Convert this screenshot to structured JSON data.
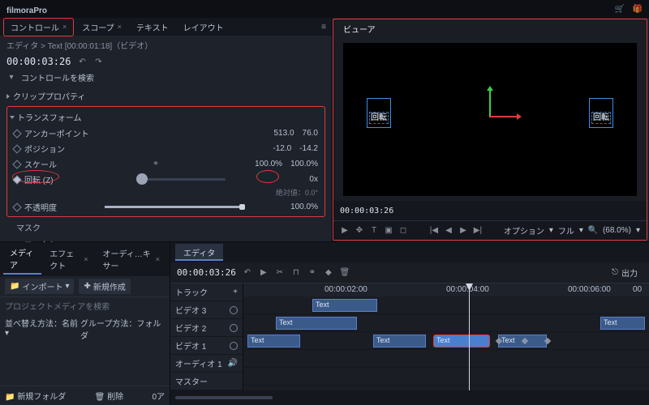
{
  "app": {
    "name": "filmoraPro"
  },
  "titlebar_icons": [
    "cart",
    "gift"
  ],
  "left": {
    "tabs": [
      {
        "label": "コントロール",
        "active": true,
        "closable": true
      },
      {
        "label": "スコープ",
        "closable": true
      },
      {
        "label": "テキスト"
      },
      {
        "label": "レイアウト"
      }
    ],
    "breadcrumb": "エディタ > Text [00:00:01:18]（ビデオ）",
    "timecode": "00:00:03:26",
    "search_placeholder": "コントロールを検索",
    "clip_props": "クリッププロパティ",
    "transform": {
      "title": "トランスフォーム",
      "rows": [
        {
          "name": "アンカーポイント",
          "v1": "513.0",
          "v2": "76.0"
        },
        {
          "name": "ポジション",
          "v1": "-12.0",
          "v2": "-14.2"
        },
        {
          "name": "スケール",
          "v1": "100.0%",
          "v2": "100.0%",
          "link": true
        },
        {
          "name": "回転 (Z)",
          "rot": "0x",
          "abs": "絶対値：0.0°"
        },
        {
          "name": "不透明度",
          "pct": "100.0%"
        }
      ]
    },
    "mask": "マスク",
    "effect": "エフェクト"
  },
  "viewer": {
    "tab": "ビューア",
    "text_left": "回転",
    "text_right": "回転",
    "tc": "00:00:03:26",
    "options": "オプション",
    "full": "フル",
    "zoom": "(68.0%)"
  },
  "media": {
    "tabs": [
      {
        "label": "メディア",
        "active": true
      },
      {
        "label": "エフェクト",
        "closable": true
      },
      {
        "label": "オーディ…キサー",
        "closable": true
      }
    ],
    "import": "インポート",
    "new": "新規作成",
    "search": "プロジェクトメディアを検索",
    "sort_label": "並べ替え方法：名前",
    "group_label": "グループ方法：フォルダ",
    "new_folder": "新規フォルダ",
    "delete": "削除",
    "count": "0ア"
  },
  "timeline": {
    "tab": "エディタ",
    "tc": "00:00:03:26",
    "export": "出力",
    "ruler": [
      "00:00:02:00",
      "00:00:04:00",
      "00:00:06:00",
      "00"
    ],
    "tracks": {
      "track": "トラック",
      "v3": "ビデオ 3",
      "v2": "ビデオ 2",
      "v1": "ビデオ 1",
      "a1": "オーディオ 1",
      "master": "マスター"
    },
    "clip_label": "Text"
  }
}
